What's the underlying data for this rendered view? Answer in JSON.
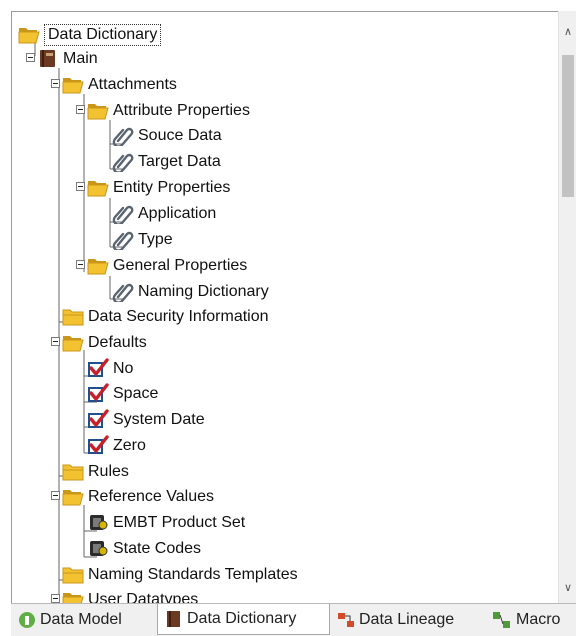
{
  "tree": {
    "nodes": [
      {
        "label": "Data Dictionary",
        "icon": "folder-open-icon",
        "selected": true
      },
      {
        "label": "Main",
        "icon": "book-icon"
      },
      {
        "label": "Attachments",
        "icon": "folder-open-icon"
      },
      {
        "label": "Attribute Properties",
        "icon": "folder-open-icon"
      },
      {
        "label": "Souce Data",
        "icon": "paperclip-icon"
      },
      {
        "label": "Target Data",
        "icon": "paperclip-icon"
      },
      {
        "label": "Entity Properties",
        "icon": "folder-open-icon"
      },
      {
        "label": "Application",
        "icon": "paperclip-icon"
      },
      {
        "label": "Type",
        "icon": "paperclip-icon"
      },
      {
        "label": "General Properties",
        "icon": "folder-open-icon"
      },
      {
        "label": "Naming Dictionary",
        "icon": "paperclip-icon"
      },
      {
        "label": "Data Security Information",
        "icon": "folder-closed-icon"
      },
      {
        "label": "Defaults",
        "icon": "folder-open-icon"
      },
      {
        "label": "No",
        "icon": "checkmark-icon"
      },
      {
        "label": "Space",
        "icon": "checkmark-icon"
      },
      {
        "label": "System Date",
        "icon": "checkmark-icon"
      },
      {
        "label": "Zero",
        "icon": "checkmark-icon"
      },
      {
        "label": "Rules",
        "icon": "folder-closed-icon"
      },
      {
        "label": "Reference Values",
        "icon": "folder-open-icon"
      },
      {
        "label": "EMBT Product Set",
        "icon": "reference-values-icon"
      },
      {
        "label": "State Codes",
        "icon": "reference-values-icon"
      },
      {
        "label": "Naming Standards Templates",
        "icon": "folder-closed-icon"
      },
      {
        "label": "User Datatypes",
        "icon": "folder-open-icon"
      }
    ]
  },
  "tabs": [
    {
      "label": "Data Model",
      "icon": "data-model-icon",
      "active": false
    },
    {
      "label": "Data Dictionary",
      "icon": "book-icon",
      "active": true
    },
    {
      "label": "Data Lineage",
      "icon": "data-lineage-icon",
      "active": false
    },
    {
      "label": "Macro",
      "icon": "macro-icon",
      "active": false
    }
  ],
  "colors": {
    "folder": "#f2c230",
    "folder_dark": "#c9961a",
    "check_red": "#c8202a",
    "check_box": "#1f4f8c",
    "clip": "#5a6470",
    "book": "#6b3a22"
  }
}
